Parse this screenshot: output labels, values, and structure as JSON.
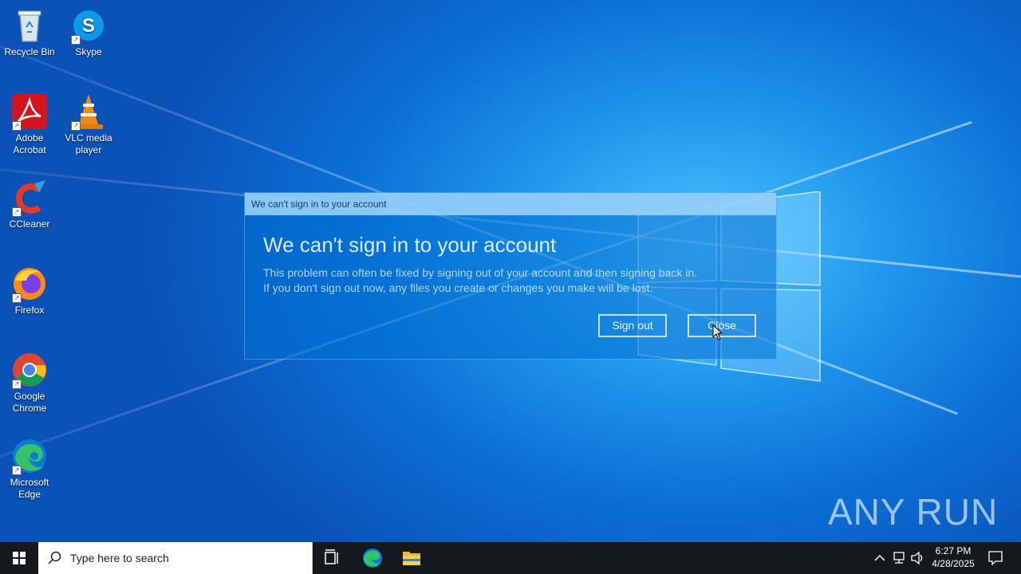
{
  "desktop": {
    "icons": [
      {
        "label": "Recycle Bin"
      },
      {
        "label": "Skype"
      },
      {
        "label": "Adobe Acrobat"
      },
      {
        "label": "VLC media player"
      },
      {
        "label": "CCleaner"
      },
      {
        "label": "Firefox"
      },
      {
        "label": "Google Chrome"
      },
      {
        "label": "Microsoft Edge"
      }
    ]
  },
  "dialog": {
    "title": "We can't sign in to your account",
    "heading": "We can't sign in to your account",
    "line1": "This problem can often be fixed by signing out of your account and then signing back in.",
    "line2": "If you don't sign out now, any files you create or changes you make will be lost.",
    "signout_label": "Sign out",
    "close_label": "Close"
  },
  "watermark": {
    "text": "ANY RUN"
  },
  "taskbar": {
    "search_placeholder": "Type here to search",
    "time": "6:27 PM",
    "date": "4/28/2025"
  },
  "colors": {
    "accent": "#0078d7",
    "taskbar": "#15181d"
  }
}
